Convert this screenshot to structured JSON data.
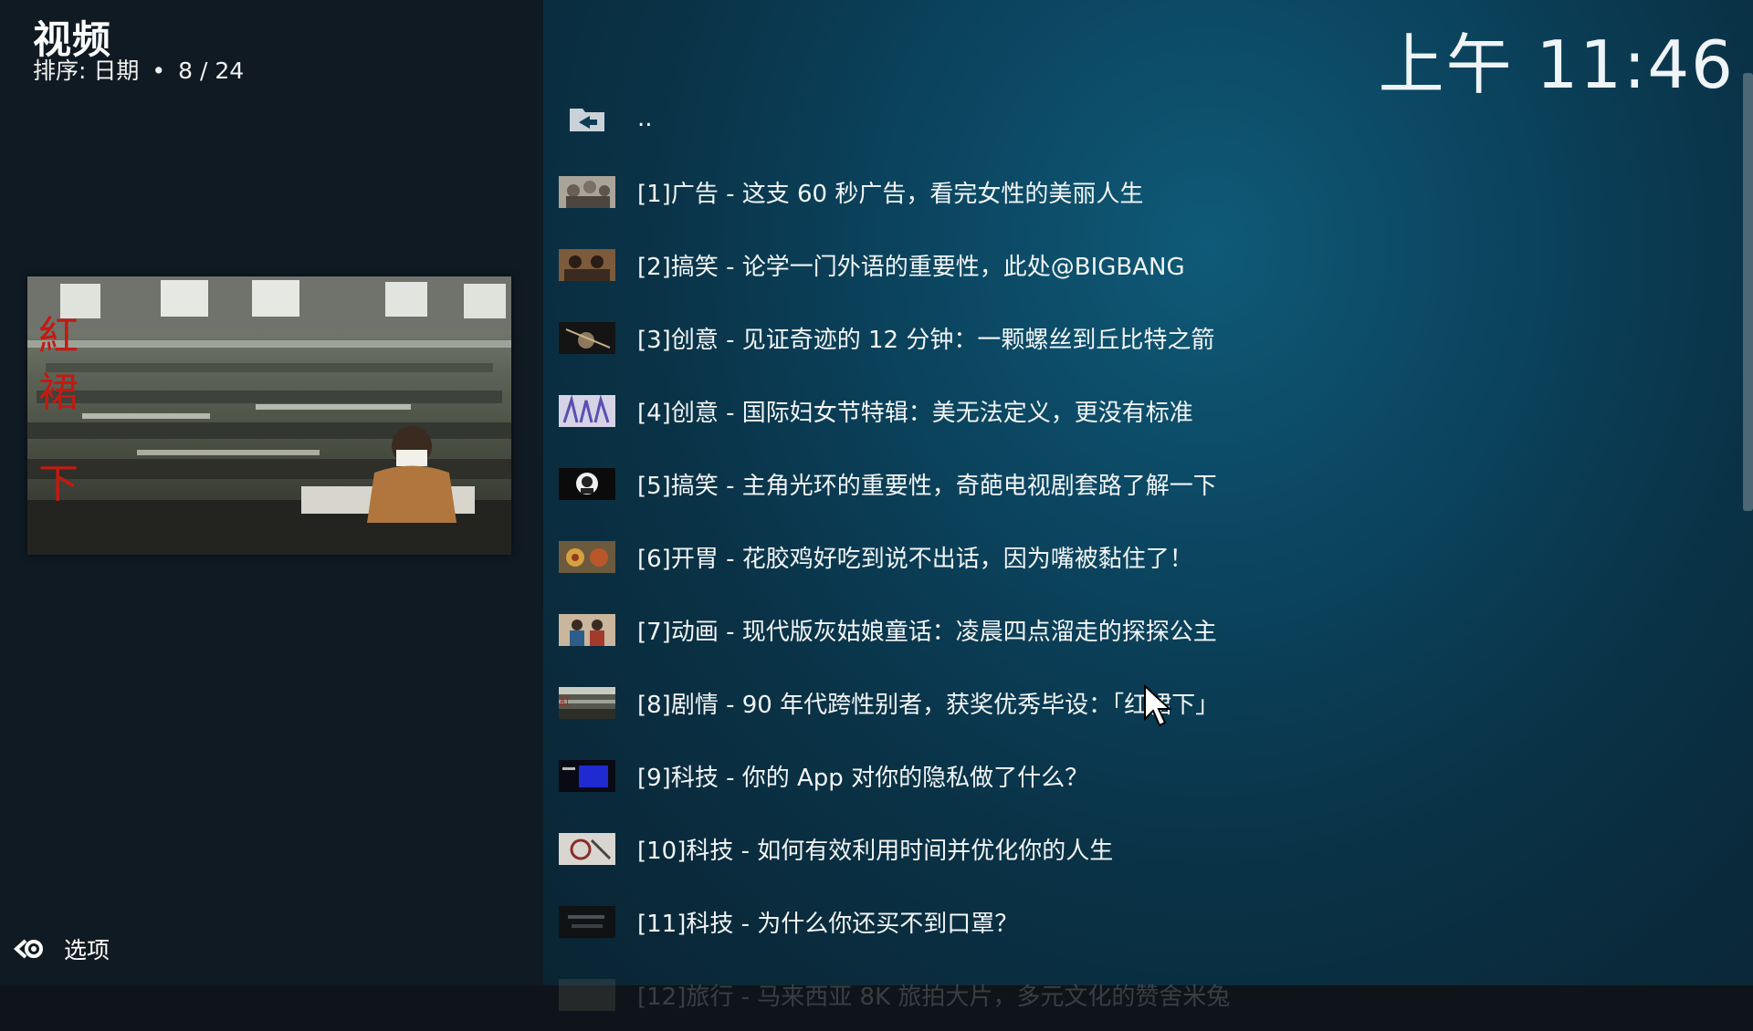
{
  "header": {
    "title": "视频",
    "sort_label": "排序: 日期",
    "dot": "•",
    "position": "8 / 24"
  },
  "clock": "上午 11:46",
  "options": {
    "label": "选项",
    "icon": "gear-arrow-icon"
  },
  "preview": {
    "overlay_text": "紅裙下"
  },
  "list": {
    "items": [
      {
        "label": "..",
        "icon": "folder-back-icon"
      },
      {
        "label": "[1]广告 - 这支 60 秒广告，看完女性的美丽人生"
      },
      {
        "label": "[2]搞笑 - 论学一门外语的重要性，此处@BIGBANG"
      },
      {
        "label": "[3]创意 - 见证奇迹的 12 分钟：一颗螺丝到丘比特之箭"
      },
      {
        "label": "[4]创意 - 国际妇女节特辑：美无法定义，更没有标准"
      },
      {
        "label": "[5]搞笑 - 主角光环的重要性，奇葩电视剧套路了解一下"
      },
      {
        "label": "[6]开胃 - 花胶鸡好吃到说不出话，因为嘴被黏住了！"
      },
      {
        "label": "[7]动画 - 现代版灰姑娘童话：凌晨四点溜走的探探公主"
      },
      {
        "label": "[8]剧情 - 90 年代跨性别者，获奖优秀毕设：「红裙下」"
      },
      {
        "label": "[9]科技 - 你的 App 对你的隐私做了什么？"
      },
      {
        "label": "[10]科技 - 如何有效利用时间并优化你的人生"
      },
      {
        "label": "[11]科技 -  为什么你还买不到口罩？"
      },
      {
        "label": "[12]旅行 - 马来西亚 8K 旅拍大片，多元文化的赞舍米兔"
      }
    ]
  },
  "colors": {
    "left_bg": "#101a23",
    "right_bg": "#0b4560",
    "text": "#f2f5f7"
  }
}
